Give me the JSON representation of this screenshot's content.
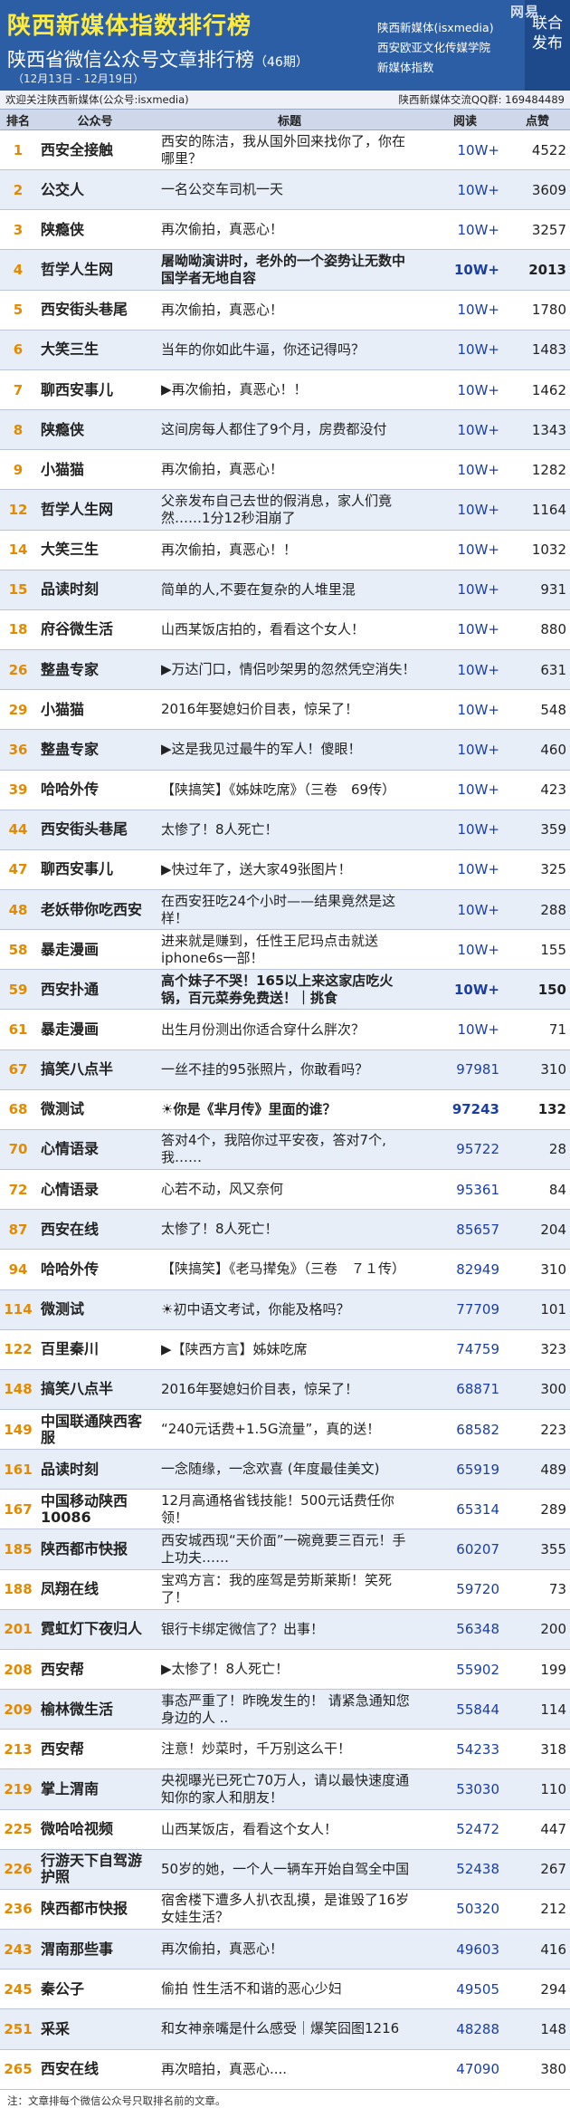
{
  "header": {
    "title": "陕西新媒体指数排行榜",
    "subtitle": "陕西省微信公众号文章排行榜",
    "period": "（46期）",
    "dates": "（12月13日 - 12月19日）",
    "right_lines": [
      "陕西新媒体(isxmedia)",
      "西安欧亚文化传媒学院",
      "新媒体指数"
    ],
    "watermark": "网易",
    "side_text": "联合发布"
  },
  "info": {
    "left": "欢迎关注陕西新媒体(公众号:isxmedia)",
    "right": "陕西新媒体交流QQ群: 169484489"
  },
  "columns": [
    "排名",
    "公众号",
    "标题",
    "阅读",
    "点赞"
  ],
  "rows": [
    {
      "rank": "1",
      "account": "西安全接触",
      "title": "西安的陈洁，我从国外回来找你了，你在哪里？",
      "read": "10W+",
      "like": "4522"
    },
    {
      "rank": "2",
      "account": "公交人",
      "title": "一名公交车司机一天",
      "read": "10W+",
      "like": "3609"
    },
    {
      "rank": "3",
      "account": "陕瘾侠",
      "title": "再次偷拍，真恶心！",
      "read": "10W+",
      "like": "3257"
    },
    {
      "rank": "4",
      "account": "哲学人生网",
      "title": "屠呦呦演讲时，老外的一个姿势让无数中国学者无地自容",
      "read": "10W+",
      "like": "2013",
      "hl": true
    },
    {
      "rank": "5",
      "account": "西安街头巷尾",
      "title": "再次偷拍，真恶心！",
      "read": "10W+",
      "like": "1780"
    },
    {
      "rank": "6",
      "account": "大笑三生",
      "title": "当年的你如此牛逼，你还记得吗？",
      "read": "10W+",
      "like": "1483"
    },
    {
      "rank": "7",
      "account": "聊西安事儿",
      "title": "▶再次偷拍，真恶心！！",
      "read": "10W+",
      "like": "1462"
    },
    {
      "rank": "8",
      "account": "陕瘾侠",
      "title": "这间房每人都住了9个月，房费都没付",
      "read": "10W+",
      "like": "1343"
    },
    {
      "rank": "9",
      "account": "小猫猫",
      "title": "再次偷拍，真恶心！",
      "read": "10W+",
      "like": "1282"
    },
    {
      "rank": "12",
      "account": "哲学人生网",
      "title": "父亲发布自己去世的假消息，家人们竟然……1分12秒泪崩了",
      "read": "10W+",
      "like": "1164"
    },
    {
      "rank": "14",
      "account": "大笑三生",
      "title": "再次偷拍，真恶心！！",
      "read": "10W+",
      "like": "1032"
    },
    {
      "rank": "15",
      "account": "品读时刻",
      "title": "简单的人,不要在复杂的人堆里混",
      "read": "10W+",
      "like": "931"
    },
    {
      "rank": "18",
      "account": "府谷微生活",
      "title": "山西某饭店拍的，看看这个女人！",
      "read": "10W+",
      "like": "880"
    },
    {
      "rank": "26",
      "account": "整蛊专家",
      "title": "▶万达门口，情侣吵架男的忽然凭空消失！",
      "read": "10W+",
      "like": "631"
    },
    {
      "rank": "29",
      "account": "小猫猫",
      "title": "2016年娶媳妇价目表，惊呆了！",
      "read": "10W+",
      "like": "548"
    },
    {
      "rank": "36",
      "account": "整蛊专家",
      "title": "▶这是我见过最牛的军人！傻眼！",
      "read": "10W+",
      "like": "460"
    },
    {
      "rank": "39",
      "account": "哈哈外传",
      "title": "【陕搞笑】《姊妹吃席》（三卷　69传）",
      "read": "10W+",
      "like": "423"
    },
    {
      "rank": "44",
      "account": "西安街头巷尾",
      "title": "太惨了！8人死亡！",
      "read": "10W+",
      "like": "359"
    },
    {
      "rank": "47",
      "account": "聊西安事儿",
      "title": "▶快过年了，送大家49张图片！",
      "read": "10W+",
      "like": "325"
    },
    {
      "rank": "48",
      "account": "老妖带你吃西安",
      "title": "在西安狂吃24个小时——结果竟然是这样！",
      "read": "10W+",
      "like": "288"
    },
    {
      "rank": "58",
      "account": "暴走漫画",
      "title": "进来就是赚到，任性王尼玛点击就送iphone6s一部！",
      "read": "10W+",
      "like": "155"
    },
    {
      "rank": "59",
      "account": "西安扑通",
      "title": "高个妹子不哭！165以上来这家店吃火锅，百元菜券免费送！｜挑食",
      "read": "10W+",
      "like": "150",
      "hl": true
    },
    {
      "rank": "61",
      "account": "暴走漫画",
      "title": "出生月份测出你适合穿什么胖次？",
      "read": "10W+",
      "like": "71"
    },
    {
      "rank": "67",
      "account": "搞笑八点半",
      "title": "一丝不挂的95张照片，你敢看吗？",
      "read": "97981",
      "like": "310"
    },
    {
      "rank": "68",
      "account": "微测试",
      "title": "☀你是《芈月传》里面的谁？",
      "read": "97243",
      "like": "132",
      "hl": true
    },
    {
      "rank": "70",
      "account": "心情语录",
      "title": "答对4个，我陪你过平安夜，答对7个,我……",
      "read": "95722",
      "like": "28"
    },
    {
      "rank": "72",
      "account": "心情语录",
      "title": "心若不动，风又奈何",
      "read": "95361",
      "like": "84"
    },
    {
      "rank": "87",
      "account": "西安在线",
      "title": "太惨了！8人死亡！",
      "read": "85657",
      "like": "204"
    },
    {
      "rank": "94",
      "account": "哈哈外传",
      "title": "【陕搞笑】《老马撵兔》（三卷　７１传）",
      "read": "82949",
      "like": "310"
    },
    {
      "rank": "114",
      "account": "微测试",
      "title": "☀初中语文考试，你能及格吗？",
      "read": "77709",
      "like": "101"
    },
    {
      "rank": "122",
      "account": "百里秦川",
      "title": "▶【陕西方言】姊妹吃席",
      "read": "74759",
      "like": "323"
    },
    {
      "rank": "148",
      "account": "搞笑八点半",
      "title": "2016年娶媳妇价目表，惊呆了！",
      "read": "68871",
      "like": "300"
    },
    {
      "rank": "149",
      "account": "中国联通陕西客服",
      "title": "“240元话费+1.5G流量”，真的送！",
      "read": "68582",
      "like": "223"
    },
    {
      "rank": "161",
      "account": "品读时刻",
      "title": "一念随缘，一念欢喜 (年度最佳美文)",
      "read": "65919",
      "like": "489"
    },
    {
      "rank": "167",
      "account": "中国移动陕西10086",
      "title": "12月高通格省钱技能！500元话费任你领！",
      "read": "65314",
      "like": "289"
    },
    {
      "rank": "185",
      "account": "陕西都市快报",
      "title": "西安城西现“天价面”一碗竟要三百元！手上功夫……",
      "read": "60207",
      "like": "355"
    },
    {
      "rank": "188",
      "account": "凤翔在线",
      "title": "宝鸡方言：我的座驾是劳斯莱斯！笑死了！",
      "read": "59720",
      "like": "73"
    },
    {
      "rank": "201",
      "account": "霓虹灯下夜归人",
      "title": "银行卡绑定微信了？出事！",
      "read": "56348",
      "like": "200"
    },
    {
      "rank": "208",
      "account": "西安帮",
      "title": "▶太惨了！8人死亡！",
      "read": "55902",
      "like": "199"
    },
    {
      "rank": "209",
      "account": "榆林微生活",
      "title": "事态严重了！昨晚发生的！ 请紧急通知您身边的人 ..",
      "read": "55844",
      "like": "114"
    },
    {
      "rank": "213",
      "account": "西安帮",
      "title": "注意！炒菜时，千万别这么干！",
      "read": "54233",
      "like": "318"
    },
    {
      "rank": "219",
      "account": "掌上渭南",
      "title": "央视曝光已死亡70万人，请以最快速度通知你的家人和朋友！",
      "read": "53030",
      "like": "110"
    },
    {
      "rank": "225",
      "account": "微哈哈视频",
      "title": "山西某饭店，看看这个女人！",
      "read": "52472",
      "like": "447"
    },
    {
      "rank": "226",
      "account": "行游天下自驾游护照",
      "title": "50岁的她，一个人一辆车开始自驾全中国",
      "read": "52438",
      "like": "267"
    },
    {
      "rank": "236",
      "account": "陕西都市快报",
      "title": "宿舍楼下遭多人扒衣乱摸，是谁毁了16岁女娃生活？",
      "read": "50320",
      "like": "212"
    },
    {
      "rank": "243",
      "account": "渭南那些事",
      "title": "再次偷拍，真恶心！",
      "read": "49603",
      "like": "416"
    },
    {
      "rank": "245",
      "account": "秦公子",
      "title": "偷拍 性生活不和谐的恶心少妇",
      "read": "49505",
      "like": "294"
    },
    {
      "rank": "251",
      "account": "采采",
      "title": "和女神亲嘴是什么感受｜爆笑囧图1216",
      "read": "48288",
      "like": "148"
    },
    {
      "rank": "265",
      "account": "西安在线",
      "title": "再次暗拍，真恶心....",
      "read": "47090",
      "like": "380"
    }
  ],
  "footer": "注：文章排每个微信公众号只取排名前的文章。",
  "colors": {
    "header_bg": "#2c5ea5",
    "title_yellow": "#ffeb3b",
    "rank_orange": "#e38a00",
    "read_blue": "#1a3ea3",
    "row_alt": "#e7eef8"
  }
}
